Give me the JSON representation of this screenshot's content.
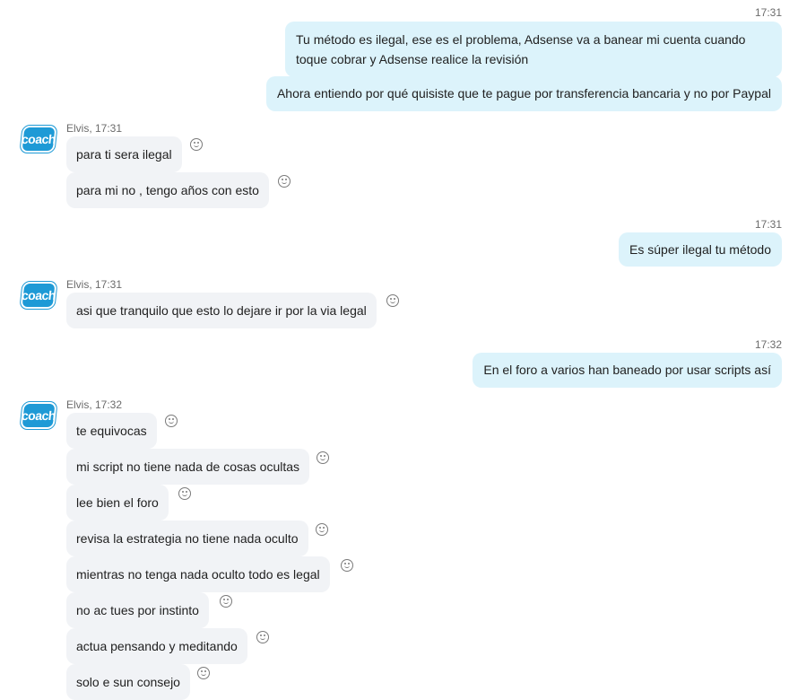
{
  "icons": {
    "avatar": "coach-logo-icon",
    "reaction": "smiley-reaction-icon"
  },
  "colors": {
    "outgoing_bubble": "#dcf3fb",
    "incoming_bubble": "#f1f3f6",
    "avatar": "#1e9ad6"
  },
  "avatar_text": "coach",
  "outgoing_groups": [
    {
      "time": "17:31",
      "messages": [
        "Tu método es ilegal, ese es el problema, Adsense va a banear mi cuenta cuando toque cobrar y Adsense realice la revisión",
        "Ahora entiendo por qué quisiste que te pague por transferencia bancaria y no por Paypal"
      ]
    },
    {
      "time": "17:31",
      "messages": [
        "Es súper ilegal tu método"
      ]
    },
    {
      "time": "17:32",
      "messages": [
        "En el foro a varios han baneado por usar scripts así"
      ]
    }
  ],
  "incoming_groups": [
    {
      "sender": "Elvis, 17:31",
      "messages": [
        "para ti sera ilegal",
        "para mi no , tengo años con esto"
      ]
    },
    {
      "sender": "Elvis, 17:31",
      "messages": [
        "asi que tranquilo que esto lo dejare ir por la via legal"
      ]
    },
    {
      "sender": "Elvis, 17:32",
      "messages": [
        "te equivocas",
        "mi script no tiene nada de cosas ocultas",
        "lee bien el foro",
        "revisa la estrategia no tiene nada oculto",
        "mientras no tenga nada oculto todo es legal",
        "no ac tues por instinto",
        "actua pensando y meditando",
        "solo e sun consejo"
      ]
    }
  ]
}
